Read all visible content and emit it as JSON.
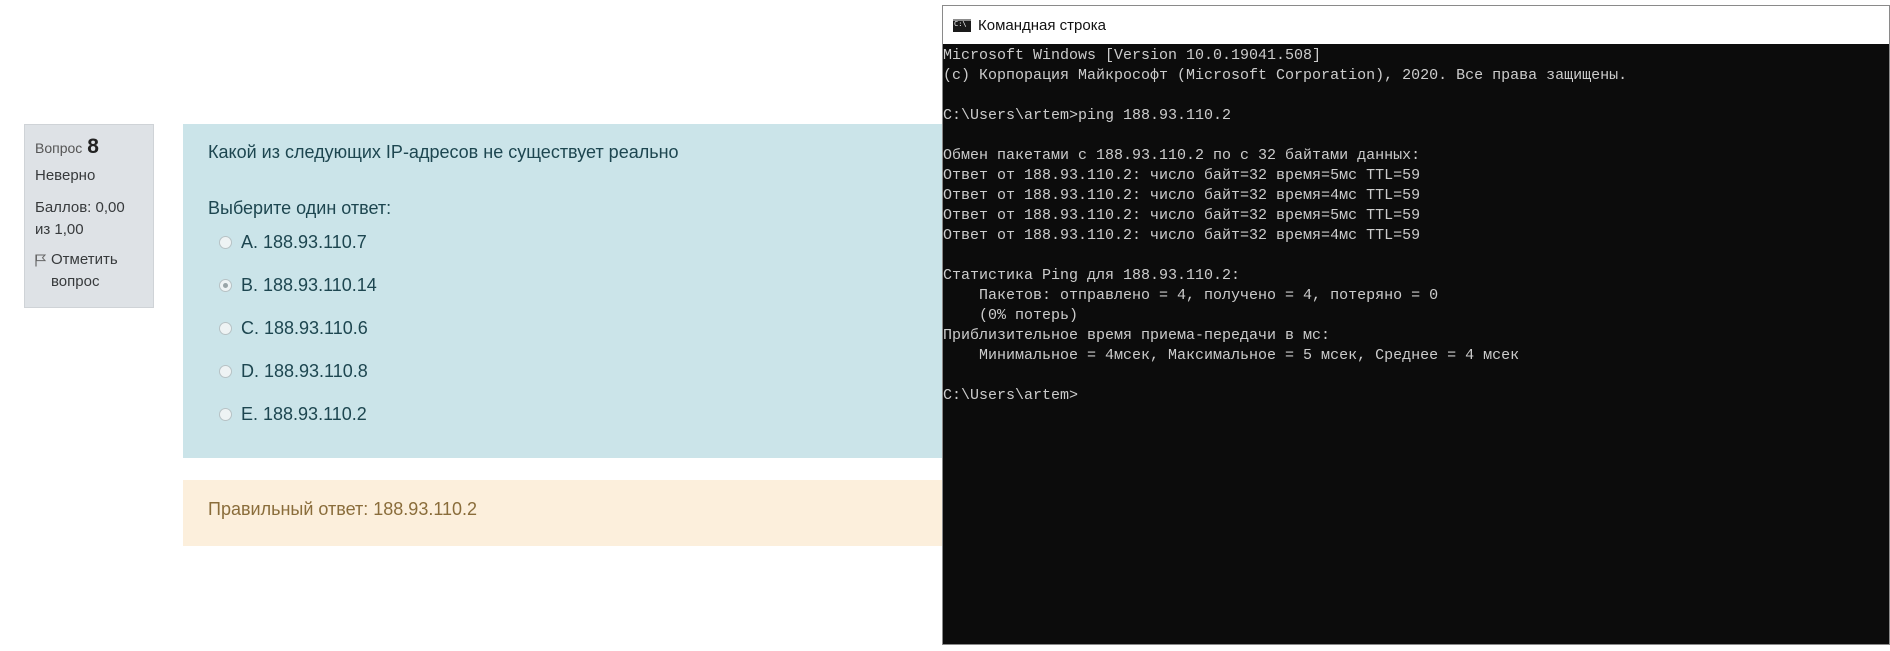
{
  "quiz": {
    "info": {
      "question_label": "Вопрос",
      "question_number": "8",
      "state": "Неверно",
      "grade": "Баллов: 0,00 из 1,00",
      "flag_label": "Отметить вопрос"
    },
    "question_text": "Какой из следующих IP-адресов не существует реально",
    "prompt": "Выберите один ответ:",
    "answers": [
      {
        "label": "A. 188.93.110.7",
        "checked": false
      },
      {
        "label": "B. 188.93.110.14",
        "checked": true
      },
      {
        "label": "C. 188.93.110.6",
        "checked": false
      },
      {
        "label": "D. 188.93.110.8",
        "checked": false
      },
      {
        "label": "E. 188.93.110.2",
        "checked": false
      }
    ],
    "correct_answer": "Правильный ответ: 188.93.110.2"
  },
  "console": {
    "title": "Командная строка",
    "lines": [
      "Microsoft Windows [Version 10.0.19041.508]",
      "(c) Корпорация Майкрософт (Microsoft Corporation), 2020. Все права защищены.",
      "",
      "C:\\Users\\artem>ping 188.93.110.2",
      "",
      "Обмен пакетами с 188.93.110.2 по с 32 байтами данных:",
      "Ответ от 188.93.110.2: число байт=32 время=5мс TTL=59",
      "Ответ от 188.93.110.2: число байт=32 время=4мс TTL=59",
      "Ответ от 188.93.110.2: число байт=32 время=5мс TTL=59",
      "Ответ от 188.93.110.2: число байт=32 время=4мс TTL=59",
      "",
      "Статистика Ping для 188.93.110.2:",
      "    Пакетов: отправлено = 4, получено = 4, потеряно = 0",
      "    (0% потерь)",
      "Приблизительное время приема-передачи в мс:",
      "    Минимальное = 4мсек, Максимальное = 5 мсек, Среднее = 4 мсек",
      "",
      "C:\\Users\\artem>"
    ]
  }
}
